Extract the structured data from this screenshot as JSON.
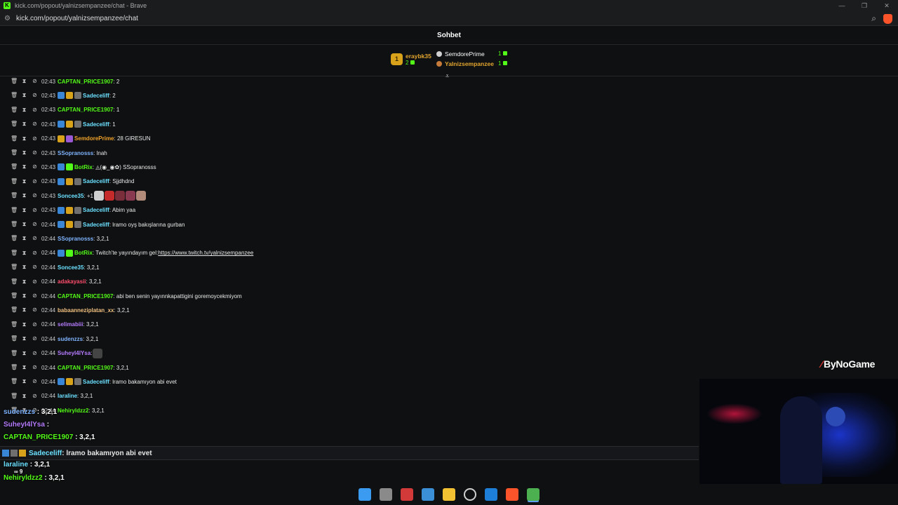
{
  "window": {
    "title": "kick.com/popout/yalnizsempanzee/chat - Brave",
    "url": "kick.com/popout/yalnizsempanzee/chat",
    "controls": [
      "—",
      "❐",
      "✕"
    ]
  },
  "chat": {
    "title": "Sohbet",
    "leaderboard": {
      "first": {
        "rank": "1",
        "name": "eraybk35",
        "count": "2"
      },
      "others": [
        {
          "name": "SemdorePrime",
          "count": "1"
        },
        {
          "name": "Yalnizsempanzee",
          "count": "1"
        }
      ]
    },
    "messages": [
      {
        "time": "02:43",
        "badges": [],
        "user": "CAPTAN_PRICE1907",
        "color": "#53fc18",
        "text": ": 2"
      },
      {
        "time": "02:43",
        "badges": [
          "mod",
          "sub",
          "vip"
        ],
        "user": "Sadeceliff",
        "color": "#6be0ff",
        "text": ": 2"
      },
      {
        "time": "02:43",
        "badges": [],
        "user": "CAPTAN_PRICE1907",
        "color": "#53fc18",
        "text": ": 1"
      },
      {
        "time": "02:43",
        "badges": [
          "mod",
          "sub",
          "vip"
        ],
        "user": "Sadeceliff",
        "color": "#6be0ff",
        "text": ": 1"
      },
      {
        "time": "02:43",
        "badges": [
          "sub",
          "og"
        ],
        "user": "SemdorePrime",
        "color": "#f0a32b",
        "text": ": 28 GIRESUN"
      },
      {
        "time": "02:43",
        "badges": [],
        "user": "SSopranosss",
        "color": "#7fb4ff",
        "text": ": lnah"
      },
      {
        "time": "02:43",
        "badges": [
          "mod",
          "bot"
        ],
        "user": "BotRix",
        "color": "#53fc18",
        "text": ": ◬(◉_◉✿) SSopranosss"
      },
      {
        "time": "02:43",
        "badges": [
          "mod",
          "sub",
          "vip"
        ],
        "user": "Sadeceliff",
        "color": "#6be0ff",
        "text": ": Sjjdhdnd"
      },
      {
        "time": "02:43",
        "badges": [],
        "user": "Soncee35",
        "color": "#6be0ff",
        "text": ": +1",
        "emotes": [
          "#cfcfcf",
          "#c62b2b",
          "#7a2d3a",
          "#8a3a50",
          "#b28b7a"
        ]
      },
      {
        "time": "02:43",
        "badges": [
          "mod",
          "sub",
          "vip"
        ],
        "user": "Sadeceliff",
        "color": "#6be0ff",
        "text": ": Abim yaa"
      },
      {
        "time": "02:44",
        "badges": [
          "mod",
          "sub",
          "vip"
        ],
        "user": "Sadeceliff",
        "color": "#6be0ff",
        "text": ": lramo oyş bakışlarına gurban"
      },
      {
        "time": "02:44",
        "badges": [],
        "user": "SSopranosss",
        "color": "#7fb4ff",
        "text": ": 3,2,1"
      },
      {
        "time": "02:44",
        "badges": [
          "mod",
          "bot"
        ],
        "user": "BotRix",
        "color": "#53fc18",
        "text": ": Twitch'te yayındayım gel: ",
        "link": "https://www.twitch.tv/yalnizsempanzee"
      },
      {
        "time": "02:44",
        "badges": [],
        "user": "Soncee35",
        "color": "#6be0ff",
        "text": ": 3,2,1"
      },
      {
        "time": "02:44",
        "badges": [],
        "user": "adakayasii",
        "color": "#ff4d6d",
        "text": ": 3,2,1"
      },
      {
        "time": "02:44",
        "badges": [],
        "user": "CAPTAN_PRICE1907",
        "color": "#53fc18",
        "text": ": abi ben senin yayınnkapattigini goremoycekmiyom"
      },
      {
        "time": "02:44",
        "badges": [],
        "user": "babaanneziplatan_xx",
        "color": "#f0c080",
        "text": ": 3,2,1"
      },
      {
        "time": "02:44",
        "badges": [],
        "user": "selimabiii",
        "color": "#b57cff",
        "text": ": 3,2,1"
      },
      {
        "time": "02:44",
        "badges": [],
        "user": "sudenzzs",
        "color": "#7fb4ff",
        "text": ": 3,2,1"
      },
      {
        "time": "02:44",
        "badges": [],
        "user": "Suheyl4lYsa",
        "color": "#b57cff",
        "text": ":",
        "emotes": [
          "#444444"
        ]
      },
      {
        "time": "02:44",
        "badges": [],
        "user": "CAPTAN_PRICE1907",
        "color": "#53fc18",
        "text": ": 3,2,1"
      },
      {
        "time": "02:44",
        "badges": [
          "mod",
          "sub",
          "vip"
        ],
        "user": "Sadeceliff",
        "color": "#6be0ff",
        "text": ": lramo bakamıyon abi evet"
      },
      {
        "time": "02:44",
        "badges": [],
        "user": "laraline",
        "color": "#6be0ff",
        "text": ": 3,2,1"
      },
      {
        "time": "02:44",
        "badges": [],
        "user": "Nehiryldzz2",
        "color": "#53fc18",
        "text": ": 3,2,1"
      }
    ]
  },
  "overlay": {
    "lines": [
      {
        "user": "sudenzzs",
        "color": "#7fb4ff",
        "text": " : 3,2,1"
      },
      {
        "user": "SuheyI4lYsa",
        "color": "#b57cff",
        "text": " :"
      },
      {
        "user": "CAPTAN_PRICE1907",
        "color": "#53fc18",
        "text": " : 3,2,1"
      }
    ],
    "pinned": {
      "user": "Sadeceliff",
      "color": "#6be0ff",
      "text": " : lramo bakamıyon abi evet"
    },
    "bottom": [
      {
        "user": "laraline",
        "color": "#6be0ff",
        "text": " : 3,2,1"
      },
      {
        "user": "Nehiryldzz2",
        "color": "#53fc18",
        "text": " : 3,2,1"
      }
    ],
    "misc": "∞  9"
  },
  "brand": {
    "name": "ByNoGame"
  },
  "taskbar": {
    "icons": [
      "windows-start-icon",
      "task-view-icon",
      "snipping-tool-icon",
      "photos-icon",
      "file-explorer-icon",
      "obs-icon",
      "steam-icon",
      "brave-icon",
      "chrome-icon"
    ]
  }
}
